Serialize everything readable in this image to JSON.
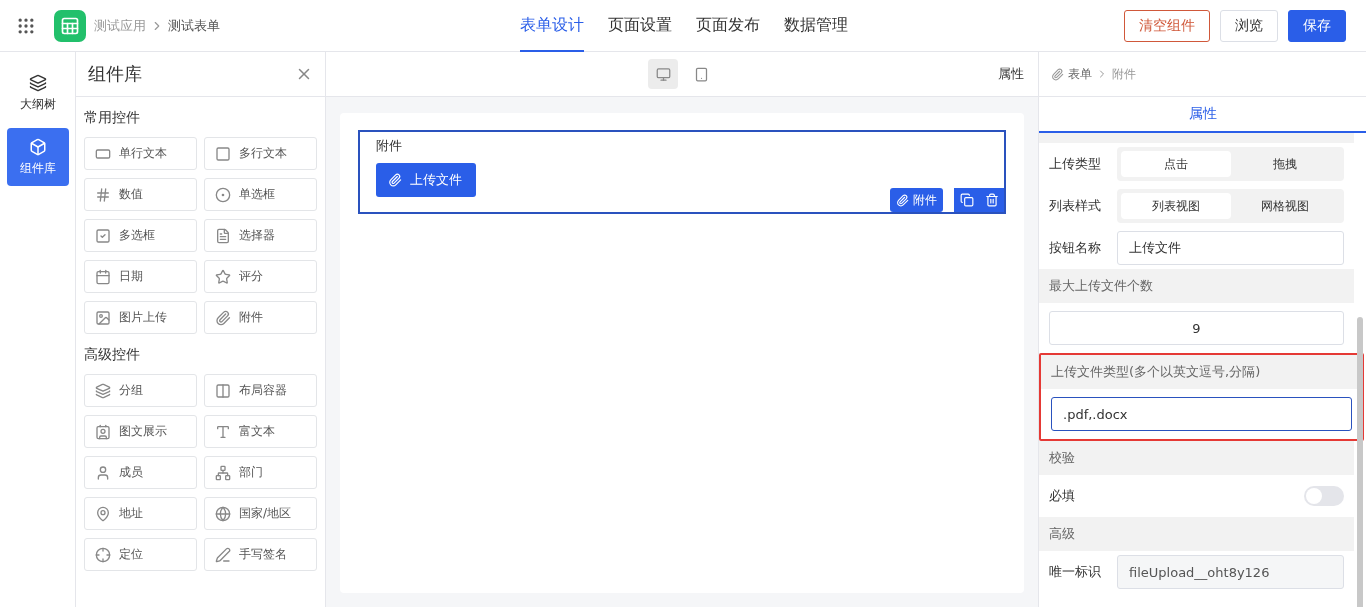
{
  "header": {
    "breadcrumb": [
      "测试应用",
      "测试表单"
    ],
    "nav": [
      {
        "label": "表单设计",
        "selected": true
      },
      {
        "label": "页面设置",
        "selected": false
      },
      {
        "label": "页面发布",
        "selected": false
      },
      {
        "label": "数据管理",
        "selected": false
      }
    ],
    "buttons": [
      {
        "label": "清空组件",
        "kind": "danger"
      },
      {
        "label": "浏览",
        "kind": "default"
      },
      {
        "label": "保存",
        "kind": "primary"
      }
    ]
  },
  "rail": [
    {
      "label": "大纲树",
      "selected": false
    },
    {
      "label": "组件库",
      "selected": true
    }
  ],
  "library": {
    "title": "组件库",
    "groups": [
      {
        "title": "常用控件",
        "items": [
          "单行文本",
          "多行文本",
          "数值",
          "单选框",
          "多选框",
          "选择器",
          "日期",
          "评分",
          "图片上传",
          "附件"
        ]
      },
      {
        "title": "高级控件",
        "items": [
          "分组",
          "布局容器",
          "图文展示",
          "富文本",
          "成员",
          "部门",
          "地址",
          "国家/地区",
          "定位",
          "手写签名"
        ]
      }
    ]
  },
  "canvas": {
    "devices": [
      {
        "selected": true
      },
      {
        "selected": false
      }
    ],
    "panel_label": "属性",
    "field": {
      "label": "附件",
      "button": "上传文件",
      "tag": "附件"
    }
  },
  "props": {
    "breadcrumb": [
      "表单",
      "附件"
    ],
    "tab": "属性",
    "rows": [
      {
        "kind": "segment",
        "label": "上传类型",
        "options": [
          {
            "label": "点击",
            "selected": true
          },
          {
            "label": "拖拽",
            "selected": false
          }
        ]
      },
      {
        "kind": "segment",
        "label": "列表样式",
        "options": [
          {
            "label": "列表视图",
            "selected": true
          },
          {
            "label": "网格视图",
            "selected": false
          }
        ]
      },
      {
        "kind": "input",
        "label": "按钮名称",
        "value": "上传文件"
      },
      {
        "kind": "section",
        "label": "最大上传文件个数"
      },
      {
        "kind": "number",
        "value": "9"
      },
      {
        "kind": "section",
        "label": "上传文件类型(多个以英文逗号,分隔)",
        "highlight": true
      },
      {
        "kind": "input_full",
        "value": ".pdf,.docx",
        "focused": true
      },
      {
        "kind": "section",
        "label": "校验"
      },
      {
        "kind": "switch",
        "label": "必填",
        "on": false
      },
      {
        "kind": "section",
        "label": "高级"
      },
      {
        "kind": "input",
        "label": "唯一标识",
        "value": "fileUpload__oht8y126",
        "disabled": true
      }
    ]
  }
}
